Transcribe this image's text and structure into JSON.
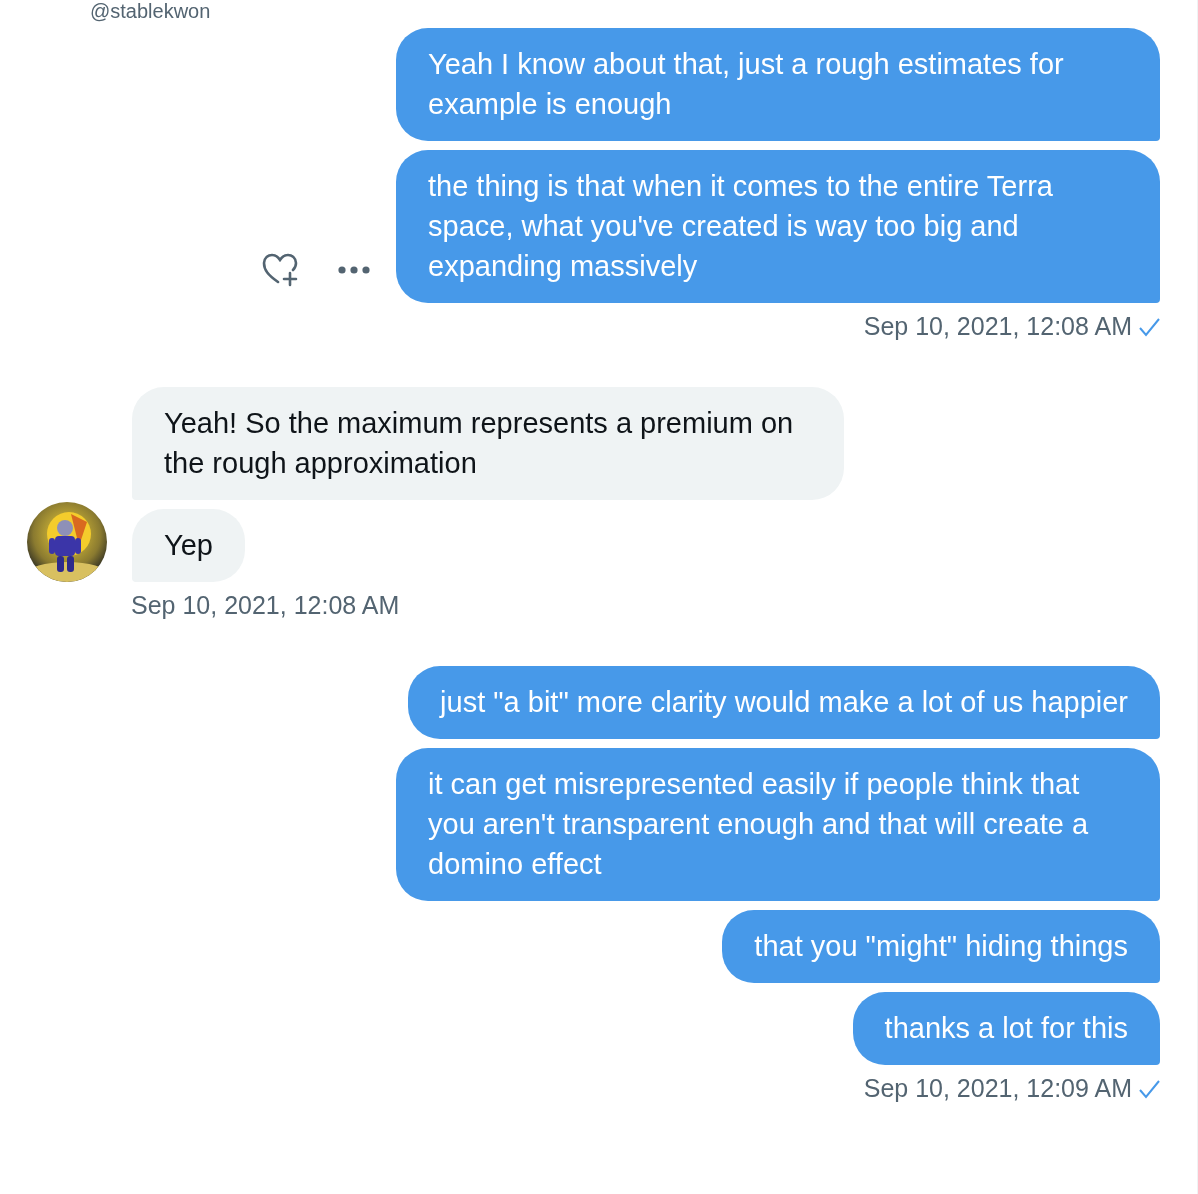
{
  "header": {
    "handle": "@stablekwon"
  },
  "groups": [
    {
      "kind": "sent",
      "seen": true,
      "timestamp": "Sep 10, 2021, 12:08 AM",
      "messages": [
        {
          "text": "Yeah I know about that, just a rough estimates for example is enough",
          "show_actions": false
        },
        {
          "text": "the thing is that when it comes to the entire Terra space, what you've created is way too big and expanding massively",
          "show_actions": true
        }
      ]
    },
    {
      "kind": "received",
      "timestamp": "Sep 10, 2021, 12:08 AM",
      "messages": [
        {
          "text": "Yeah! So the maximum represents a premium on the rough approximation",
          "show_actions": false
        },
        {
          "text": "Yep",
          "show_actions": false
        }
      ]
    },
    {
      "kind": "sent",
      "seen": true,
      "timestamp": "Sep 10, 2021, 12:09 AM",
      "messages": [
        {
          "text": "just \"a bit\" more clarity would make a lot of us happier",
          "show_actions": false
        },
        {
          "text": "it can get misrepresented easily if people think that you aren't transparent enough and that will create a domino effect",
          "show_actions": false
        },
        {
          "text": "that you \"might\" hiding things",
          "show_actions": false
        },
        {
          "text": "thanks a lot for this",
          "show_actions": false
        }
      ]
    }
  ]
}
